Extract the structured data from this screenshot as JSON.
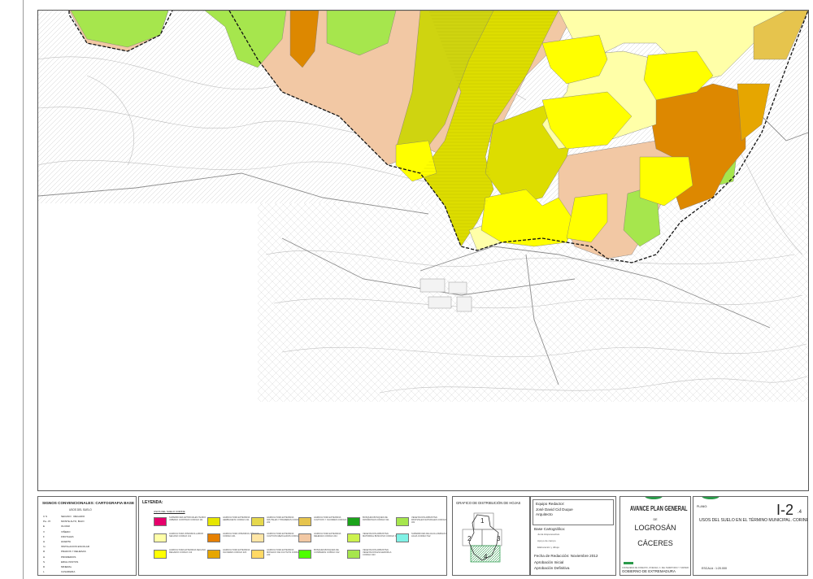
{
  "signos": {
    "title": "SIGNOS CONVENCIONALES: CARTOGRAFIA BASE",
    "subtitle": "USOS DEL SUELO",
    "rows": [
      {
        "code": "C   S",
        "label": "SECANO · REGADIO"
      },
      {
        "code": "Pa - Pt",
        "label": "MONTE ALTO, BAJO"
      },
      {
        "code": "E",
        "label": "OLIVAR"
      },
      {
        "code": "V",
        "label": "VIÑEDO"
      },
      {
        "code": "F",
        "label": "FRUTALES"
      },
      {
        "code": "H",
        "label": "HUERTA"
      },
      {
        "code": "Iu",
        "label": "INSTALACION ESCOLAR"
      },
      {
        "code": "R",
        "label": "PRADOS Y DEHESAS"
      },
      {
        "code": "H",
        "label": "PROMEDIOS"
      },
      {
        "code": "S",
        "label": "ERIAL PASTOS"
      },
      {
        "code": "D",
        "label": "MINERAL"
      },
      {
        "code": "L",
        "label": "CASAREIRA"
      }
    ]
  },
  "leyenda": {
    "title": "LEYENDA:",
    "subtitle": "USOS DEL SUELO CORINE",
    "items": [
      {
        "color": "#e6006b",
        "text": "SUPERFICIES ARTIFICIALES TEJIDO URBANO CONTINUO CODIGO 111"
      },
      {
        "color": "#e6e600",
        "text": "AGRICULTURA EXTENSIVA HERBACEOS CODIGO 211"
      },
      {
        "color": "#e6d84c",
        "text": "AGRICULTURA EXTENSIVA FRUTALES Y PRADERAS CODIGO 222"
      },
      {
        "color": "#e6c44d",
        "text": "AGRICULTURA EXTENSIVA CULTIVOS Y OLIVARES CODIGO 223"
      },
      {
        "color": "#1aa31a",
        "text": "BOSQUES BOSQUES DE FRONDOSAS CODIGO 311"
      },
      {
        "color": "#a6e64d",
        "text": "VEGETACION ARBUSTIVA PASTIZALES NATURALES CODIGO 321"
      },
      {
        "color": "#ffffa8",
        "text": "AGRICULTURA INTENSIVA LABOR SECANO CODIGO 211"
      },
      {
        "color": "#e68000",
        "text": "AGRICULTURA INTENSIVA VIÑEDOS CODIGO 221"
      },
      {
        "color": "#ffe6a6",
        "text": "AGRICULTURA EXTENSIVA CULTIVOS MEZCLADOS CODIGO 242"
      },
      {
        "color": "#f2c8a4",
        "text": "AGRICULTURA EXTENSIVA DEHESAS CODIGO 244"
      },
      {
        "color": "#ccf24d",
        "text": "VEGETACION ARBUSTIVA MATORRAL BOSCOSO CODIGO 324"
      },
      {
        "color": "#80f2e6",
        "text": "SUPERFICIES DE AGUA LAMINAS DE AGUA CODIGO 512"
      },
      {
        "color": "#ffff00",
        "text": "AGRICULTURA EXTENSIVA SECANO REGADIO CODIGO 212"
      },
      {
        "color": "#e6a600",
        "text": "AGRICULTURA EXTENSIVA OLIVARES CODIGO 223"
      },
      {
        "color": "#ffd966",
        "text": "AGRICULTURA EXTENSIVA MOSAICO DE CULTIVOS CODIGO 243"
      },
      {
        "color": "#4dff00",
        "text": "BOSQUES BOSQUES DE CONIFERAS CODIGO 312"
      },
      {
        "color": "#a6e64d",
        "text": "VEGETACION ARBUSTIVA VEGETACION ESCLEROFILA CODIGO 323"
      }
    ]
  },
  "grafico": {
    "title": "GRAFICO DE DISTRIBUCIÓN DE HOJAS",
    "sheets": [
      "1",
      "2",
      "3",
      "4"
    ]
  },
  "equipo": {
    "label": "Equipo Redactor:",
    "name": "José David Cid Duque",
    "role": "Arquitecto"
  },
  "base": {
    "label": "Base Cartográfica:",
    "lines": [
      "Junta Hispanoactiva",
      "Apoyo de campo",
      "Elaboración y dibujo"
    ]
  },
  "fechas": {
    "redaccion": "Fecha de Redacción: Noviembre 2012",
    "inicial": "Aprobación Inicial",
    "definitiva": "Aprobación Definitiva"
  },
  "titulo": {
    "avance": "AVANCE PLAN GENERAL",
    "de": "DE",
    "municipio": "LOGROSÁN",
    "provincia": "CÁCERES",
    "consejeria": "CONSEJERIA DE FOMENTO, VIVIENDA, O. DEL TERRITORIO Y TURISMO",
    "gobierno": "GOBIERNO DE EXTREMADURA"
  },
  "plano": {
    "label": "PLANO:",
    "number": "I-2",
    "sub": ".4",
    "description": "USOS DEL SUELO EN EL TÉRMINO MUNICIPAL. CORINE",
    "escala": "ESCALA : 1:20.000"
  },
  "colors": {
    "frame": "#555555",
    "dehesa": "#f2c8a4",
    "herbaceo": "#dddd00",
    "secano": "#ffff00",
    "labor": "#ffffa8",
    "vinedo": "#dd8800",
    "pastizal": "#a6e64d",
    "green_logo": "#2a9a4a"
  }
}
